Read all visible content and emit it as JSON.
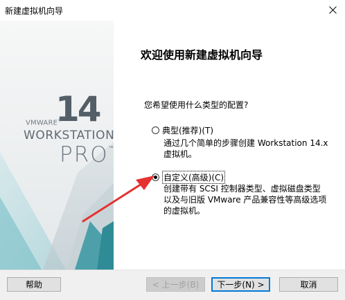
{
  "window": {
    "title": "新建虚拟机向导"
  },
  "banner": {
    "brand": "VMWARE",
    "brand_mark": "®",
    "version": "14",
    "product": "WORKSTATION",
    "edition": "PRO",
    "edition_mark": "™",
    "colors": {
      "teal": "#4aa5ae",
      "pale_teal": "#cfe7ea",
      "gray_shape": "#b9c6cc"
    }
  },
  "main": {
    "heading": "欢迎使用新建虚拟机向导",
    "question": "您希望使用什么类型的配置?",
    "options": [
      {
        "label": "典型(推荐)(T)",
        "selected": false,
        "description": [
          "通过几个简单的步骤创建 Workstation 14.x",
          "虚拟机。"
        ]
      },
      {
        "label": "自定义(高级)(C)",
        "selected": true,
        "description": [
          "创建带有 SCSI 控制器类型、虚拟磁盘类型",
          "以及与旧版 VMware 产品兼容性等高级选项",
          "的虚拟机。"
        ]
      }
    ],
    "annotation_color": "#e5312f"
  },
  "buttons": {
    "help": "帮助",
    "back": "< 上一步(B)",
    "next": "下一步(N) >",
    "cancel": "取消"
  }
}
